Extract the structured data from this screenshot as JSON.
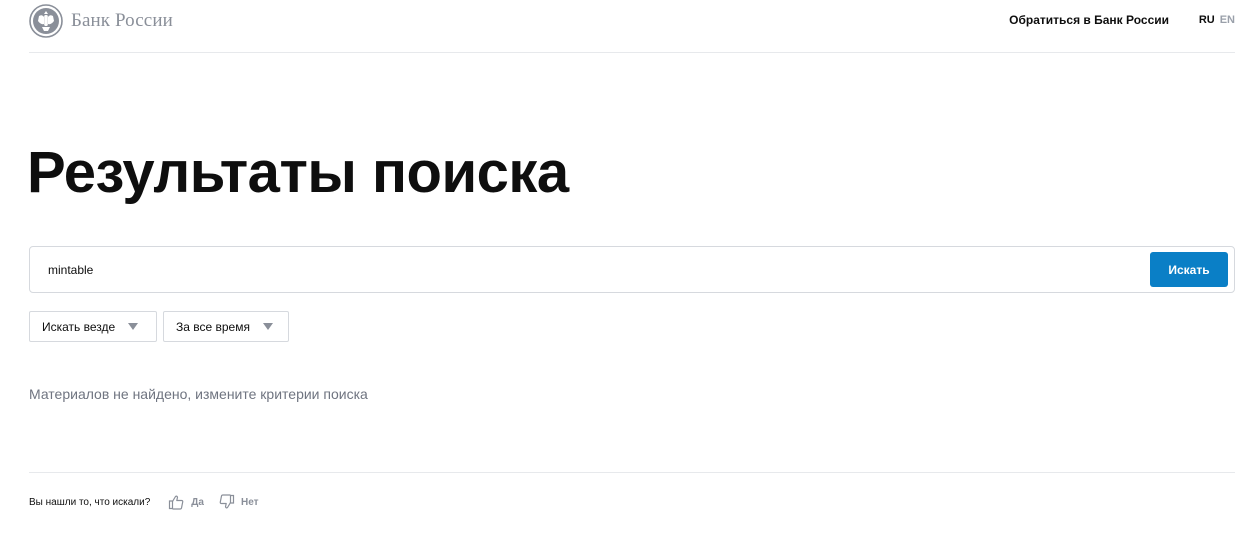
{
  "header": {
    "logo_text": "Банк России",
    "contact_link": "Обратиться в Банк России",
    "lang_ru": "RU",
    "lang_en": "EN"
  },
  "main": {
    "title": "Результаты поиска",
    "search": {
      "value": "mintable",
      "button_label": "Искать"
    },
    "filters": {
      "where_selected": "Искать везде",
      "when_selected": "За все время"
    },
    "no_results_text": "Материалов не найдено, измените критерии поиска"
  },
  "feedback": {
    "question": "Вы нашли то, что искали?",
    "yes_label": "Да",
    "no_label": "Нет"
  },
  "icons": {
    "logo": "bank-of-russia-eagle-icon",
    "filter_caret": "caret-down-icon",
    "yes": "thumbs-up-icon",
    "no": "thumbs-down-icon"
  },
  "colors": {
    "accent_button": "#0a7fc6",
    "muted_text": "#8a8f99",
    "border": "#d6d9de"
  }
}
